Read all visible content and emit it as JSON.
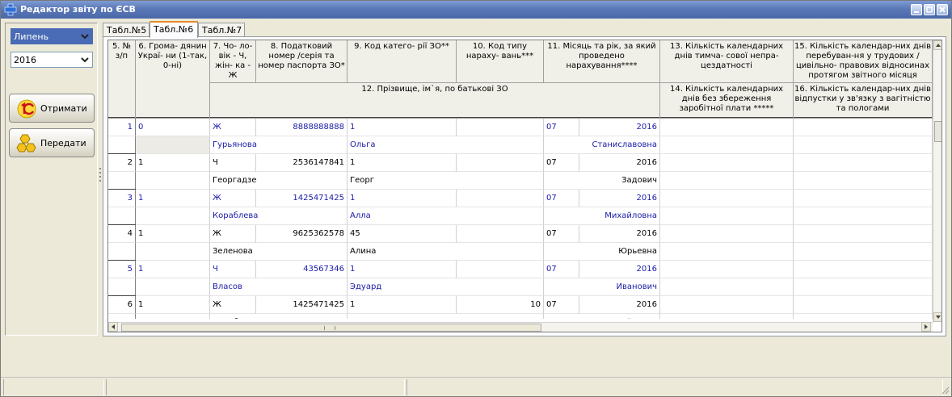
{
  "window": {
    "title": "Редактор звіту по ЄСВ"
  },
  "sidebar": {
    "month": "Липень",
    "year": "2016",
    "get_label": "Отримати",
    "send_label": "Передати"
  },
  "tabs": [
    {
      "label": "Табл.№5",
      "active": false
    },
    {
      "label": "Табл.№6",
      "active": true
    },
    {
      "label": "Табл.№7",
      "active": false
    }
  ],
  "headers": {
    "c5": "5. № з/п",
    "c6": "6. Грома- дянин Украї- ни (1-так, 0-ні)",
    "c7": "7. Чо- ло- вік - Ч, жін- ка - Ж",
    "c8": "8. Податковий номер /серія та номер паспорта ЗО*",
    "c9": "9. Код катего- рії ЗО**",
    "c10": "10. Код типу нараху- вань***",
    "c11": "11. Місяць та рік, за який проведено нарахування****",
    "c12": "12. Прізвище, ім`я, по батькові ЗО",
    "c13": "13. Кількість календарних днів тимча- сової непра- цездатності",
    "c14": "14. Кількість календарних днів без збереження заробітної плати *****",
    "c15": "15. Кількість календар-них днів перебуван-ня у трудових / цивільно- правових відносинах протягом звітного місяця",
    "c16": "16. Кількість календар-них днів відпустки у зв'язку з вагітністю та пологами"
  },
  "rows": [
    {
      "num": "1",
      "citizen": "0",
      "sex": "Ж",
      "tax": "8888888888",
      "cat": "1",
      "type": "",
      "month": "07",
      "year": "2016",
      "last": "Гурьянова",
      "first": "Ольга",
      "patr": "Станиславовна",
      "highlight": true
    },
    {
      "num": "2",
      "citizen": "1",
      "sex": "Ч",
      "tax": "2536147841",
      "cat": "1",
      "type": "",
      "month": "07",
      "year": "2016",
      "last": "Георгадзе",
      "first": "Георг",
      "patr": "Задович",
      "highlight": false
    },
    {
      "num": "3",
      "citizen": "1",
      "sex": "Ж",
      "tax": "1425471425",
      "cat": "1",
      "type": "",
      "month": "07",
      "year": "2016",
      "last": "Кораблева",
      "first": "Алла",
      "patr": "Михайловна",
      "highlight": true
    },
    {
      "num": "4",
      "citizen": "1",
      "sex": "Ж",
      "tax": "9625362578",
      "cat": "45",
      "type": "",
      "month": "07",
      "year": "2016",
      "last": "Зеленова",
      "first": "Алина",
      "patr": "Юрьевна",
      "highlight": false
    },
    {
      "num": "5",
      "citizen": "1",
      "sex": "Ч",
      "tax": "43567346",
      "cat": "1",
      "type": "",
      "month": "07",
      "year": "2016",
      "last": "Власов",
      "first": "Эдуард",
      "patr": "Иванович",
      "highlight": true
    },
    {
      "num": "6",
      "citizen": "1",
      "sex": "Ж",
      "tax": "1425471425",
      "cat": "1",
      "type": "10",
      "month": "07",
      "year": "2016",
      "last": "Кораблева",
      "first": "Алла",
      "patr": "Михайловна",
      "highlight": false
    }
  ],
  "colors": {
    "highlight": "#1a1aa8",
    "title": "#5b78b7",
    "tab_accent": "#e68b2c"
  },
  "icons": {
    "app": "plus-icon",
    "get": "1c-logo-icon",
    "send": "hexagon-icon"
  }
}
